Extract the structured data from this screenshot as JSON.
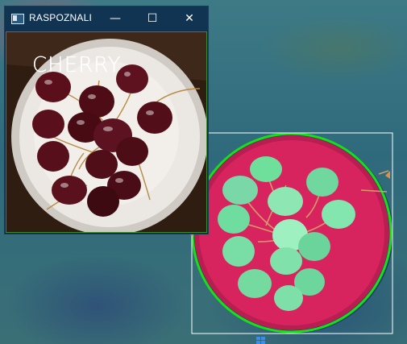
{
  "window": {
    "title": "RASPOZNALI",
    "detected_label": "CHERRY",
    "controls": {
      "minimize": "—",
      "maximize": "☐",
      "close": "✕"
    }
  },
  "detection": {
    "box_color": "#ffffff",
    "circle_color": "#18e018"
  },
  "colors": {
    "titlebar": "#123453",
    "plate_pink": "#d8245e",
    "cherry_red": "#5a0f1a",
    "cherry_green": "#6fe09c"
  }
}
